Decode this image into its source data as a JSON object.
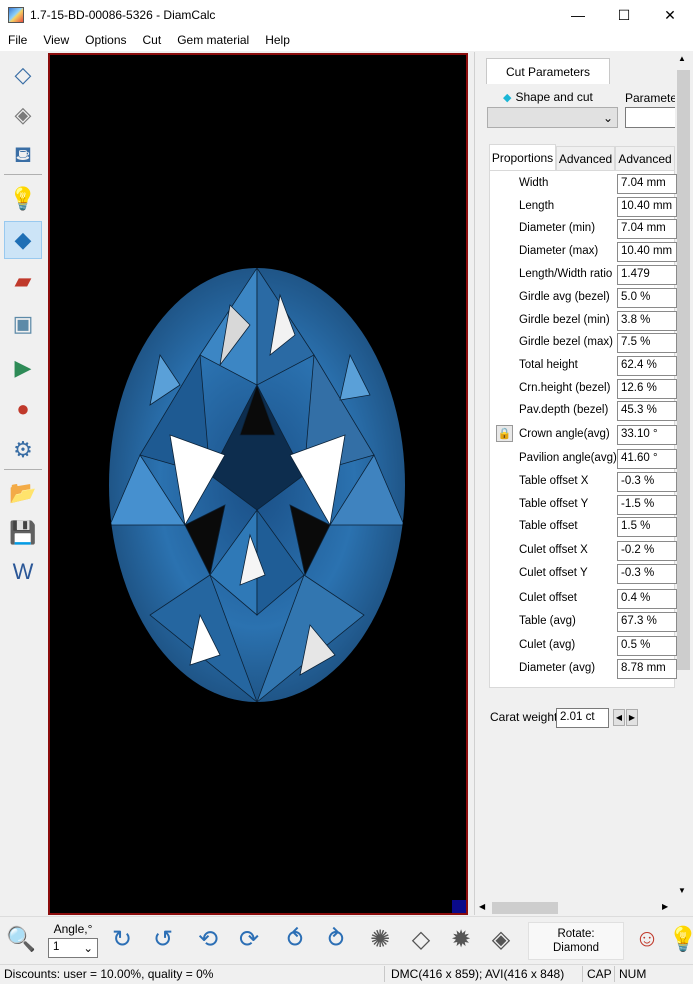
{
  "window": {
    "title": "1.7-15-BD-00086-5326 - DiamCalc",
    "minimize": "—",
    "maximize": "☐",
    "close": "✕"
  },
  "menu": [
    "File",
    "View",
    "Options",
    "Cut",
    "Gem material",
    "Help"
  ],
  "left_toolbar": [
    {
      "icon": "diamond-outline-icon",
      "glyph": "◇"
    },
    {
      "icon": "diamond-sphere-icon",
      "glyph": "◈"
    },
    {
      "icon": "paint-bucket-icon",
      "glyph": "⛾"
    },
    {
      "icon": "light-bulb-icon",
      "glyph": "💡"
    },
    {
      "icon": "diamond-render-icon",
      "glyph": "◆"
    },
    {
      "icon": "spectrum-icon",
      "glyph": "▰"
    },
    {
      "icon": "photo-icon",
      "glyph": "▣"
    },
    {
      "icon": "video-play-icon",
      "glyph": "▶"
    },
    {
      "icon": "video-record-icon",
      "glyph": "●"
    },
    {
      "icon": "diamond-settings-icon",
      "glyph": "⚙"
    },
    {
      "icon": "open-folder-icon",
      "glyph": "📂"
    },
    {
      "icon": "save-icon",
      "glyph": "💾"
    },
    {
      "icon": "word-export-icon",
      "glyph": "W"
    }
  ],
  "colors": {
    "gem_blue": "#2b6fa8",
    "gem_dark": "#0b2a4a",
    "viewport_border": "#8b0d0d",
    "active_tool": "#cce4f7"
  },
  "panel": {
    "tab": "Cut Parameters",
    "shape_label": "Shape and cut",
    "param_label": "Parameter",
    "sub_tabs": [
      "Proportions",
      "Advanced",
      "Advanced"
    ],
    "rows": [
      {
        "label": "Width",
        "value": "7.04 mm"
      },
      {
        "label": "Length",
        "value": "10.40 mm"
      },
      {
        "label": "Diameter (min)",
        "value": "7.04 mm"
      },
      {
        "label": "Diameter (max)",
        "value": "10.40 mm"
      },
      {
        "label": "Length/Width ratio",
        "value": "1.479"
      },
      {
        "label": "Girdle avg (bezel)",
        "value": "5.0 %"
      },
      {
        "label": "Girdle bezel (min)",
        "value": "3.8 %"
      },
      {
        "label": "Girdle bezel (max)",
        "value": "7.5 %"
      },
      {
        "label": "Total height",
        "value": "62.4 %"
      },
      {
        "label": "Crn.height (bezel)",
        "value": "12.6 %"
      },
      {
        "label": "Pav.depth (bezel)",
        "value": "45.3 %"
      },
      {
        "label": "Crown angle(avg)",
        "value": "33.10 °"
      },
      {
        "label": "Pavilion angle(avg)",
        "value": "41.60 °"
      },
      {
        "label": "Table offset X",
        "value": "-0.3 %"
      },
      {
        "label": "Table offset Y",
        "value": "-1.5 %"
      },
      {
        "label": "Table offset",
        "value": "1.5 %"
      },
      {
        "label": "Culet offset X",
        "value": "-0.2 %"
      },
      {
        "label": "Culet offset Y",
        "value": "-0.3 %"
      },
      {
        "label": "Culet offset",
        "value": "0.4 %"
      },
      {
        "label": "Table (avg)",
        "value": "67.3 %"
      },
      {
        "label": "Culet (avg)",
        "value": "0.5 %"
      },
      {
        "label": "Diameter (avg)",
        "value": "8.78 mm"
      }
    ],
    "carat_label": "Carat weight",
    "carat_value": "2.01 ct"
  },
  "bottom_toolbar": {
    "angle_label": "Angle,°",
    "angle_value": "1",
    "rotate_title": "Rotate:",
    "rotate_target": "Diamond",
    "icons": [
      {
        "icon": "zoom-icon",
        "glyph": "🔍"
      },
      {
        "icon": "rotate-cw-icon",
        "glyph": "↻"
      },
      {
        "icon": "rotate-ccw-icon",
        "glyph": "↺"
      },
      {
        "icon": "flip-vertical-left-icon",
        "glyph": "⟲"
      },
      {
        "icon": "flip-vertical-right-icon",
        "glyph": "⟳"
      },
      {
        "icon": "flip-horizontal-up-icon",
        "glyph": "⥀"
      },
      {
        "icon": "flip-horizontal-down-icon",
        "glyph": "⥁"
      },
      {
        "icon": "top-view-icon",
        "glyph": "✺"
      },
      {
        "icon": "side-view-icon",
        "glyph": "◇"
      },
      {
        "icon": "bottom-view-icon",
        "glyph": "✹"
      },
      {
        "icon": "angle-view-icon",
        "glyph": "◈"
      },
      {
        "icon": "user-rotate-icon",
        "glyph": "☺"
      },
      {
        "icon": "light-rotate-icon",
        "glyph": "💡"
      }
    ]
  },
  "status": {
    "discounts": "Discounts: user = 10.00%, quality = 0%",
    "dmc": "DMC(416 x 859); AVI(416 x 848)",
    "cap": "CAP",
    "num": "NUM"
  }
}
